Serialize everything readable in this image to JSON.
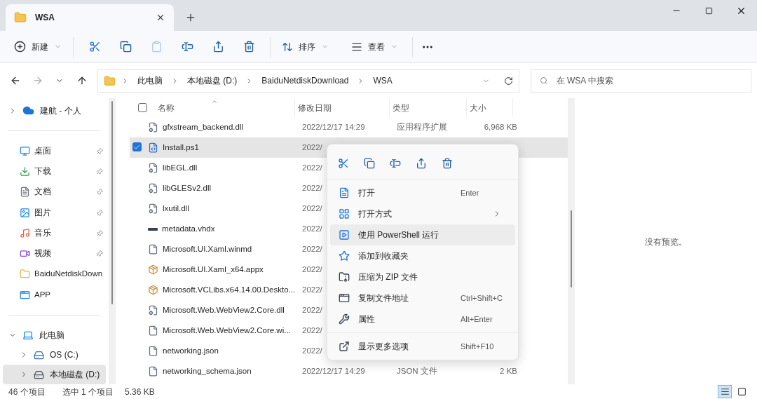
{
  "window": {
    "tab_title": "WSA"
  },
  "toolbar": {
    "new_label": "新建",
    "sort_label": "排序",
    "view_label": "查看",
    "actions": [
      {
        "kind": "cut",
        "disabled": false
      },
      {
        "kind": "copy",
        "disabled": false
      },
      {
        "kind": "paste",
        "disabled": true
      },
      {
        "kind": "rename",
        "disabled": false
      },
      {
        "kind": "share",
        "disabled": false
      },
      {
        "kind": "delete",
        "disabled": false
      }
    ]
  },
  "navigation": [
    {
      "kind": "back",
      "disabled": false
    },
    {
      "kind": "forward",
      "disabled": true
    },
    {
      "kind": "recent",
      "disabled": false
    },
    {
      "kind": "up",
      "disabled": false
    }
  ],
  "address": {
    "breadcrumbs": [
      "此电脑",
      "本地磁盘 (D:)",
      "BaiduNetdiskDownload",
      "WSA"
    ]
  },
  "search": {
    "placeholder": "在 WSA 中搜索"
  },
  "sidebar": {
    "cloud": {
      "label": "建航 - 个人",
      "expanded": false
    },
    "quick_access": [
      {
        "label": "桌面",
        "kind": "desktop",
        "pinned": true
      },
      {
        "label": "下载",
        "kind": "downloads",
        "pinned": true
      },
      {
        "label": "文档",
        "kind": "documents",
        "pinned": true
      },
      {
        "label": "图片",
        "kind": "pictures",
        "pinned": true
      },
      {
        "label": "音乐",
        "kind": "music",
        "pinned": true
      },
      {
        "label": "视频",
        "kind": "videos",
        "pinned": true
      },
      {
        "label": "BaiduNetdiskDown",
        "kind": "folder",
        "pinned": false
      },
      {
        "label": "APP",
        "kind": "app",
        "pinned": false
      }
    ],
    "tree": [
      {
        "label": "此电脑",
        "kind": "pc",
        "expanded": true,
        "selected": false,
        "children": [
          {
            "label": "OS (C:)",
            "kind": "drive",
            "expanded": false,
            "selected": false
          },
          {
            "label": "本地磁盘 (D:)",
            "kind": "disk",
            "expanded": false,
            "selected": true
          }
        ]
      }
    ]
  },
  "file_list": {
    "select_all_checked": false,
    "columns": [
      {
        "label": "名称",
        "sorted": true
      },
      {
        "label": "修改日期",
        "sorted": false
      },
      {
        "label": "类型",
        "sorted": false
      },
      {
        "label": "大小",
        "sorted": false
      }
    ],
    "rows": [
      {
        "name": "gfxstream_backend.dll",
        "kind": "dll",
        "date": "2022/12/17 14:29",
        "type": "应用程序扩展",
        "size": "6,968 KB",
        "selected": false
      },
      {
        "name": "Install.ps1",
        "kind": "script",
        "date": "2022/",
        "selected": true
      },
      {
        "name": "libEGL.dll",
        "kind": "dll",
        "date": "2022/",
        "selected": false
      },
      {
        "name": "libGLESv2.dll",
        "kind": "dll",
        "date": "2022/",
        "selected": false
      },
      {
        "name": "lxutil.dll",
        "kind": "dll",
        "date": "2022/",
        "selected": false
      },
      {
        "name": "metadata.vhdx",
        "kind": "disk",
        "date": "2022/",
        "selected": false
      },
      {
        "name": "Microsoft.UI.Xaml.winmd",
        "kind": "file",
        "date": "2022/",
        "selected": false
      },
      {
        "name": "Microsoft.UI.Xaml_x64.appx",
        "kind": "package",
        "date": "2022/",
        "selected": false
      },
      {
        "name": "Microsoft.VCLibs.x64.14.00.Deskto...",
        "kind": "package",
        "date": "2022/",
        "selected": false
      },
      {
        "name": "Microsoft.Web.WebView2.Core.dll",
        "kind": "dll",
        "date": "2022/",
        "selected": false
      },
      {
        "name": "Microsoft.Web.WebView2.Core.wi...",
        "kind": "file",
        "date": "2022/",
        "selected": false
      },
      {
        "name": "networking.json",
        "kind": "file",
        "date": "2022/",
        "selected": false
      },
      {
        "name": "networking_schema.json",
        "kind": "file",
        "date": "2022/12/17 14:29",
        "type": "JSON 文件",
        "size": "2 KB",
        "selected": false
      }
    ]
  },
  "context_menu": {
    "quick_actions": [
      {
        "kind": "cut"
      },
      {
        "kind": "copy"
      },
      {
        "kind": "rename"
      },
      {
        "kind": "share"
      },
      {
        "kind": "delete"
      }
    ],
    "groups": [
      [
        {
          "label": "打开",
          "kind": "open",
          "shortcut": "Enter",
          "submenu": false,
          "highlighted": false
        },
        {
          "label": "打开方式",
          "kind": "open_with",
          "submenu": true,
          "highlighted": false
        },
        {
          "label": "使用 PowerShell 运行",
          "kind": "run",
          "submenu": false,
          "highlighted": true
        },
        {
          "label": "添加到收藏夹",
          "kind": "favorite",
          "submenu": false,
          "highlighted": false
        },
        {
          "label": "压缩为 ZIP 文件",
          "kind": "zip",
          "submenu": false,
          "highlighted": false
        },
        {
          "label": "复制文件地址",
          "kind": "copy_path",
          "shortcut": "Ctrl+Shift+C",
          "submenu": false,
          "highlighted": false
        },
        {
          "label": "属性",
          "kind": "properties",
          "shortcut": "Alt+Enter",
          "submenu": false,
          "highlighted": false
        }
      ],
      [
        {
          "label": "显示更多选项",
          "kind": "more",
          "shortcut": "Shift+F10",
          "submenu": false,
          "highlighted": false
        }
      ]
    ]
  },
  "preview": {
    "message": "没有预览。"
  },
  "status_bar": {
    "item_count": "46 个项目",
    "selection": "选中 1 个项目",
    "selection_size": "5.36 KB",
    "views": [
      {
        "kind": "details",
        "selected": true
      },
      {
        "kind": "tiles",
        "selected": false
      }
    ]
  }
}
